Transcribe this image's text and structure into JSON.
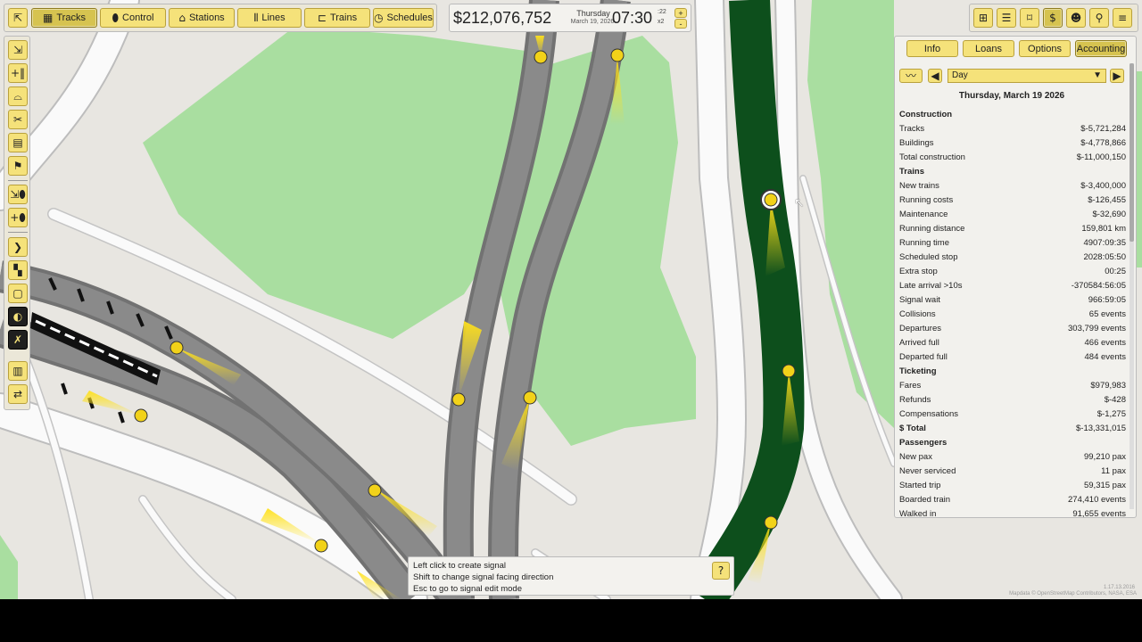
{
  "toolbar": {
    "tracks": "Tracks",
    "control": "Control",
    "stations": "Stations",
    "lines": "Lines",
    "trains": "Trains",
    "schedules": "Schedules"
  },
  "status": {
    "money": "$212,076,752",
    "day_name": "Thursday",
    "date": "March 19, 2026",
    "time": "07:30",
    "seconds": ":22",
    "speed": "x2",
    "speed_up": "+",
    "speed_down": "-"
  },
  "panel": {
    "tabs": [
      "Info",
      "Loans",
      "Options",
      "Accounting"
    ],
    "period": "Day",
    "date_heading": "Thursday, March 19 2026",
    "rows": [
      {
        "label": "Construction",
        "value": "",
        "header": true
      },
      {
        "label": "Tracks",
        "value": "$-5,721,284"
      },
      {
        "label": "Buildings",
        "value": "$-4,778,866"
      },
      {
        "label": "Total construction",
        "value": "$-11,000,150"
      },
      {
        "label": "Trains",
        "value": "",
        "header": true
      },
      {
        "label": "New trains",
        "value": "$-3,400,000"
      },
      {
        "label": "Running costs",
        "value": "$-126,455"
      },
      {
        "label": "Maintenance",
        "value": "$-32,690"
      },
      {
        "label": "Running distance",
        "value": "159,801 km"
      },
      {
        "label": "Running time",
        "value": "4907:09:35"
      },
      {
        "label": "Scheduled stop",
        "value": "2028:05:50"
      },
      {
        "label": "Extra stop",
        "value": "00:25"
      },
      {
        "label": "Late arrival >10s",
        "value": "-370584:56:05"
      },
      {
        "label": "Signal wait",
        "value": "966:59:05"
      },
      {
        "label": "Collisions",
        "value": "65 events"
      },
      {
        "label": "Departures",
        "value": "303,799 events"
      },
      {
        "label": "Arrived full",
        "value": "466 events"
      },
      {
        "label": "Departed full",
        "value": "484 events"
      },
      {
        "label": "Ticketing",
        "value": "",
        "header": true
      },
      {
        "label": "Fares",
        "value": "$979,983"
      },
      {
        "label": "Refunds",
        "value": "$-428"
      },
      {
        "label": "Compensations",
        "value": "$-1,275"
      },
      {
        "label": "$ Total",
        "value": "$-13,331,015",
        "header": true
      },
      {
        "label": "Passengers",
        "value": "",
        "header": true
      },
      {
        "label": "New pax",
        "value": "99,210 pax"
      },
      {
        "label": "Never serviced",
        "value": "11 pax"
      },
      {
        "label": "Started trip",
        "value": "59,315 pax"
      },
      {
        "label": "Boarded train",
        "value": "274,410 events"
      },
      {
        "label": "Walked in",
        "value": "91,655 events"
      }
    ]
  },
  "tooltip": {
    "line1": "Left click to create signal",
    "line2": "Shift to change signal facing direction",
    "line3": "Esc to go to signal edit mode"
  },
  "footer": {
    "version": "1.17.13.2016",
    "copyright": "Mapdata © OpenStreetMap Contributors, NASA, ESA"
  },
  "colors": {
    "accent": "#f5e27a",
    "park": "#a9dea0",
    "track": "#7a7a7a",
    "line_green": "#0d4f1c",
    "signal_glow": "#ffe11a"
  }
}
